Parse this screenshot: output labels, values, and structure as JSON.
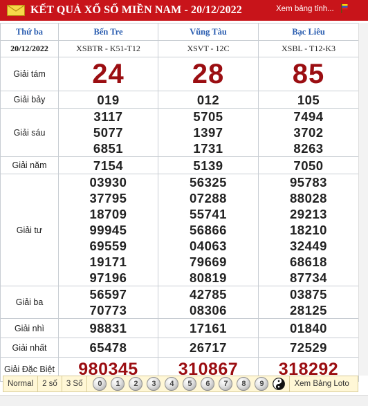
{
  "header": {
    "title": "KẾT QUẢ XỔ SỐ MIỀN NAM - 20/12/2022",
    "view_link": "Xem bảng tỉnh..."
  },
  "table": {
    "day": "Thứ ba",
    "date": "20/12/2022",
    "provinces": [
      {
        "name": "Bến Tre",
        "code": "XSBTR - K51-T12"
      },
      {
        "name": "Vũng Tàu",
        "code": "XSVT - 12C"
      },
      {
        "name": "Bạc Liêu",
        "code": "XSBL - T12-K3"
      }
    ],
    "prizes": {
      "g8": {
        "label": "Giải tám",
        "values": [
          "24",
          "28",
          "85"
        ]
      },
      "g7": {
        "label": "Giải bảy",
        "values": [
          "019",
          "012",
          "105"
        ]
      },
      "g6": {
        "label": "Giải sáu",
        "values": [
          [
            "3117",
            "5077",
            "6851"
          ],
          [
            "5705",
            "1397",
            "1731"
          ],
          [
            "7494",
            "3702",
            "8263"
          ]
        ]
      },
      "g5": {
        "label": "Giải năm",
        "values": [
          "7154",
          "5139",
          "7050"
        ]
      },
      "g4": {
        "label": "Giải tư",
        "values": [
          [
            "03930",
            "37795",
            "18709",
            "99945",
            "69559",
            "19171",
            "97196"
          ],
          [
            "56325",
            "07288",
            "55741",
            "56866",
            "04063",
            "79669",
            "80819"
          ],
          [
            "95783",
            "88028",
            "29213",
            "18210",
            "32449",
            "68618",
            "87734"
          ]
        ]
      },
      "g3": {
        "label": "Giải ba",
        "values": [
          [
            "56597",
            "70773"
          ],
          [
            "42785",
            "08306"
          ],
          [
            "03875",
            "28125"
          ]
        ]
      },
      "g2": {
        "label": "Giải nhì",
        "values": [
          "98831",
          "17161",
          "01840"
        ]
      },
      "g1": {
        "label": "Giải nhất",
        "values": [
          "65478",
          "26717",
          "72529"
        ]
      },
      "db": {
        "label": "Giải Đặc Biệt",
        "values": [
          "980345",
          "310867",
          "318292"
        ]
      }
    }
  },
  "footer": {
    "tabs": [
      "Normal",
      "2 số",
      "3 Số"
    ],
    "digits": [
      "0",
      "1",
      "2",
      "3",
      "4",
      "5",
      "6",
      "7",
      "8",
      "9"
    ],
    "loto_link": "Xem Bảng Loto"
  },
  "colors": {
    "header_bg": "#c8141a",
    "prize_red": "#9b0e12",
    "province_blue": "#2a5db0",
    "footer_bg": "#fff7d6"
  }
}
